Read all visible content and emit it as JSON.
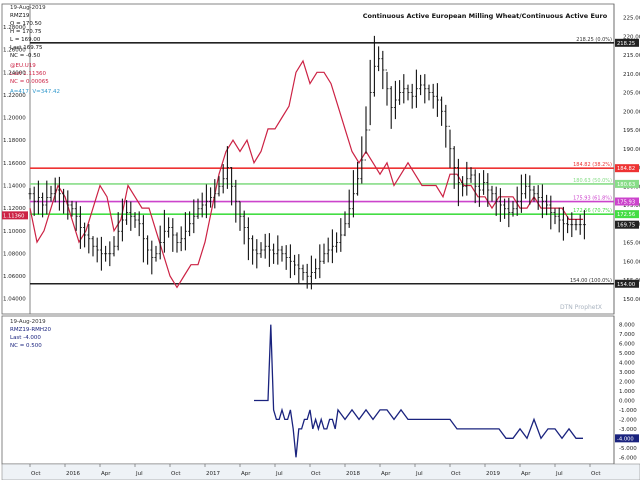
{
  "chart_data": [
    {
      "type": "line",
      "title": "Continuous Active European Milling Wheat/Continuous Active Euro",
      "legend": {
        "wheat_date": "19-Aug-2019",
        "wheat_symbol": "RMZ19",
        "wheat_open": "O = 170.50",
        "wheat_high": "H = 170.75",
        "wheat_low": "L = 169.00",
        "wheat_last": "Last 169.75",
        "wheat_nc": "NC = -0.50",
        "euro_symbol": "@EU.U19",
        "euro_last": "Last 1.11360",
        "euro_nc": "NC = 0.00065",
        "cursor_readout": "A=417, V=347.42"
      },
      "x_tick_labels": [
        "Oct",
        "2016",
        "Apr",
        "Jul",
        "Oct",
        "2017",
        "Apr",
        "Jul",
        "Oct",
        "2018",
        "Apr",
        "Jul",
        "Oct",
        "2019",
        "Apr",
        "Jul",
        "Oct"
      ],
      "left_axis": {
        "label": "Euro",
        "range": [
          1.03,
          1.295
        ],
        "ticks": [
          "1.30000",
          "1.28000",
          "1.26000",
          "1.24000",
          "1.22000",
          "1.20000",
          "1.18000",
          "1.16000",
          "1.14000",
          "1.12000",
          "1.10000",
          "1.08000",
          "1.06000",
          "1.04000"
        ],
        "last_value_label": "1.11360"
      },
      "right_axis": {
        "label": "Wheat",
        "range": [
          147,
          227
        ],
        "ticks": [
          "225.00",
          "220.00",
          "215.00",
          "210.00",
          "205.00",
          "200.00",
          "195.00",
          "190.00",
          "185.00",
          "180.00",
          "175.00",
          "170.00",
          "165.00",
          "160.00",
          "155.00",
          "150.00"
        ],
        "last_value_label": "169.75"
      },
      "horizontal_lines": [
        {
          "label": "218.25 (0.0%)",
          "value": 218.25,
          "color": "#222222",
          "axis_tag": "218.25"
        },
        {
          "label": "184.82 (38.2%)",
          "value": 184.82,
          "color": "#ee3333",
          "axis_tag": "184.82"
        },
        {
          "label": "180.63 (50.0%)",
          "value": 180.63,
          "color": "#88dd88",
          "axis_tag": "180.63"
        },
        {
          "label": "175.93 (61.8%)",
          "value": 175.93,
          "color": "#cc44cc",
          "axis_tag": "175.93"
        },
        {
          "label": "172.56 (70.7%)",
          "value": 172.56,
          "color": "#44dd44",
          "axis_tag": "172.56"
        },
        {
          "label": "154.00 (100.0%)",
          "value": 154.0,
          "color": "#222222",
          "axis_tag": "154.00"
        }
      ],
      "watermark": "DTN ProphetX",
      "series": [
        {
          "name": "RMZ19",
          "color": "#111111",
          "style": "ohlc-bars",
          "x": [
            0,
            0.03,
            0.06,
            0.09,
            0.12,
            0.15,
            0.18,
            0.21,
            0.24,
            0.27,
            0.3,
            0.33,
            0.36,
            0.39,
            0.42,
            0.45,
            0.48,
            0.51,
            0.54,
            0.57,
            0.6,
            0.63,
            0.66,
            0.69,
            0.72,
            0.75,
            0.78,
            0.81,
            0.84,
            0.87,
            0.9,
            0.93,
            0.96,
            0.99,
            1.02,
            1.05,
            1.08,
            1.11,
            1.14,
            1.17,
            1.2,
            1.23,
            1.26,
            1.29,
            1.32,
            1.35,
            1.38,
            1.41,
            1.44,
            1.47,
            1.5,
            1.53,
            1.56,
            1.59,
            1.62,
            1.65,
            1.68,
            1.71,
            1.74,
            1.77,
            1.8,
            1.83,
            1.86,
            1.89,
            1.92,
            1.95,
            1.98,
            2.01,
            2.04,
            2.07,
            2.1,
            2.13,
            2.16,
            2.19,
            2.22,
            2.25,
            2.28,
            2.31,
            2.34,
            2.37,
            2.4,
            2.43,
            2.46,
            2.49,
            2.52,
            2.55,
            2.58,
            2.61,
            2.64,
            2.67,
            2.7,
            2.73,
            2.76,
            2.79,
            2.82,
            2.85,
            2.88,
            2.91,
            2.94,
            2.97,
            3.0,
            3.03,
            3.06,
            3.09,
            3.12,
            3.15,
            3.18,
            3.21,
            3.24,
            3.27,
            3.3,
            3.33,
            3.36,
            3.39,
            3.42,
            3.45,
            3.48,
            3.51,
            3.54,
            3.57,
            3.6,
            3.63,
            3.66,
            3.69,
            3.72,
            3.75,
            3.78,
            3.81,
            3.84,
            3.87,
            3.9,
            3.93,
            3.96
          ],
          "values": [
            178,
            176,
            177,
            175,
            177,
            178,
            179,
            178,
            176,
            175,
            174,
            172,
            169,
            167,
            166,
            164,
            163,
            162,
            162,
            162,
            164,
            168,
            171,
            173,
            172,
            171,
            170,
            166,
            163,
            161,
            162,
            165,
            168,
            169,
            167,
            165,
            166,
            168,
            170,
            172,
            174,
            175,
            176,
            177,
            178,
            180,
            182,
            185,
            180,
            176,
            172,
            169,
            166,
            163,
            162,
            163,
            164,
            163,
            162,
            163,
            162,
            161,
            160,
            159,
            158,
            157,
            156,
            157,
            158,
            160,
            162,
            163,
            164,
            165,
            167,
            170,
            174,
            178,
            182,
            187,
            195,
            205,
            212,
            214,
            211,
            206,
            201,
            203,
            205,
            206,
            205,
            204,
            206,
            207,
            206,
            205,
            204,
            203,
            200,
            196,
            190,
            185,
            181,
            180,
            182,
            183,
            180,
            179,
            181,
            179,
            178,
            176,
            175,
            174,
            173,
            174,
            176,
            178,
            180,
            179,
            178,
            177,
            176,
            175,
            173,
            172,
            171,
            170,
            169.75,
            169.75,
            169.75,
            169.75,
            169.75
          ],
          "axis": "right"
        },
        {
          "name": "@EU.U19",
          "color": "#cc2244",
          "style": "line",
          "x": [
            0,
            0.05,
            0.1,
            0.15,
            0.2,
            0.25,
            0.3,
            0.35,
            0.4,
            0.45,
            0.5,
            0.55,
            0.6,
            0.65,
            0.7,
            0.75,
            0.8,
            0.85,
            0.9,
            0.95,
            1.0,
            1.05,
            1.1,
            1.15,
            1.2,
            1.25,
            1.3,
            1.35,
            1.4,
            1.45,
            1.5,
            1.55,
            1.6,
            1.65,
            1.7,
            1.75,
            1.8,
            1.85,
            1.9,
            1.95,
            2.0,
            2.05,
            2.1,
            2.15,
            2.2,
            2.25,
            2.3,
            2.35,
            2.4,
            2.45,
            2.5,
            2.55,
            2.6,
            2.65,
            2.7,
            2.75,
            2.8,
            2.85,
            2.9,
            2.95,
            3.0,
            3.05,
            3.1,
            3.15,
            3.2,
            3.25,
            3.3,
            3.35,
            3.4,
            3.45,
            3.5,
            3.55,
            3.6,
            3.65,
            3.7,
            3.75,
            3.8,
            3.85,
            3.9,
            3.95
          ],
          "values": [
            1.12,
            1.09,
            1.1,
            1.12,
            1.14,
            1.13,
            1.11,
            1.09,
            1.1,
            1.12,
            1.14,
            1.13,
            1.1,
            1.11,
            1.14,
            1.13,
            1.12,
            1.12,
            1.1,
            1.08,
            1.06,
            1.05,
            1.06,
            1.07,
            1.07,
            1.09,
            1.12,
            1.15,
            1.17,
            1.18,
            1.17,
            1.18,
            1.16,
            1.17,
            1.19,
            1.19,
            1.2,
            1.21,
            1.24,
            1.25,
            1.23,
            1.24,
            1.24,
            1.23,
            1.21,
            1.19,
            1.17,
            1.16,
            1.17,
            1.16,
            1.15,
            1.16,
            1.14,
            1.15,
            1.16,
            1.15,
            1.14,
            1.14,
            1.14,
            1.13,
            1.15,
            1.15,
            1.14,
            1.14,
            1.13,
            1.13,
            1.12,
            1.13,
            1.13,
            1.13,
            1.12,
            1.12,
            1.13,
            1.12,
            1.12,
            1.12,
            1.12,
            1.11,
            1.11,
            1.11
          ],
          "axis": "left"
        }
      ]
    },
    {
      "type": "line",
      "legend": {
        "date": "19-Aug-2019",
        "symbol": "RMZ19-RMH20",
        "last": "Last -4.000",
        "nc": "NC = 0.500"
      },
      "right_axis": {
        "range": [
          -6.5,
          8.5
        ],
        "ticks": [
          "8.000",
          "7.000",
          "6.000",
          "5.000",
          "4.000",
          "3.000",
          "2.000",
          "1.000",
          "0.000",
          "-1.000",
          "-2.000",
          "-3.000",
          "-4.000",
          "-5.000",
          "-6.000"
        ],
        "last_value_label": "-4.000"
      },
      "x_tick_labels": [
        "Oct",
        "2016",
        "Apr",
        "Jul",
        "Oct",
        "2017",
        "Apr",
        "Jul",
        "Oct",
        "2018",
        "Apr",
        "Jul",
        "Oct",
        "2019",
        "Apr",
        "Jul",
        "Oct"
      ],
      "series": [
        {
          "name": "RMZ19-RMH20",
          "color": "#1a237e",
          "x": [
            1.6,
            1.62,
            1.64,
            1.66,
            1.68,
            1.7,
            1.72,
            1.74,
            1.76,
            1.78,
            1.8,
            1.82,
            1.84,
            1.86,
            1.88,
            1.9,
            1.92,
            1.94,
            1.96,
            1.98,
            2.0,
            2.02,
            2.04,
            2.06,
            2.08,
            2.1,
            2.12,
            2.14,
            2.16,
            2.18,
            2.2,
            2.25,
            2.3,
            2.35,
            2.4,
            2.45,
            2.5,
            2.55,
            2.6,
            2.65,
            2.7,
            2.75,
            2.8,
            2.85,
            2.9,
            2.95,
            3.0,
            3.05,
            3.1,
            3.15,
            3.2,
            3.25,
            3.3,
            3.35,
            3.4,
            3.45,
            3.5,
            3.55,
            3.6,
            3.65,
            3.7,
            3.75,
            3.8,
            3.85,
            3.9,
            3.95
          ],
          "values": [
            0,
            0,
            0,
            0,
            0,
            0,
            8,
            -1,
            -2,
            -2,
            -1,
            -2,
            -2,
            -1,
            -3,
            -6,
            -3,
            -3,
            -2,
            -2,
            -1,
            -3,
            -2,
            -3,
            -2,
            -3,
            -3,
            -2,
            -2,
            -3,
            -1,
            -2,
            -1,
            -2,
            -1,
            -2,
            -1,
            -1,
            -2,
            -1,
            -2,
            -2,
            -2,
            -2,
            -2,
            -2,
            -2,
            -3,
            -3,
            -3,
            -3,
            -3,
            -3,
            -3,
            -4,
            -4,
            -3,
            -4,
            -2,
            -4,
            -3,
            -3,
            -4,
            -3,
            -4,
            -4
          ],
          "axis": "right"
        }
      ]
    }
  ]
}
